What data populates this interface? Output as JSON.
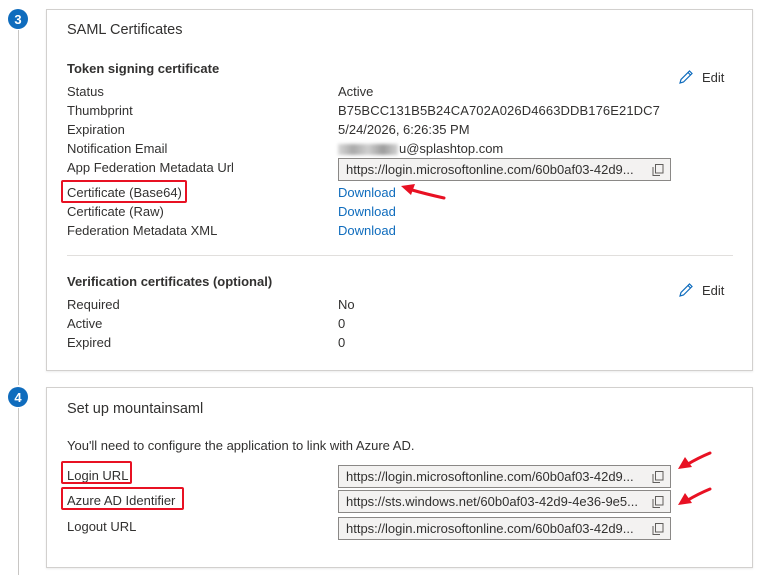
{
  "steps": [
    "3",
    "4"
  ],
  "saml": {
    "title": "SAML Certificates",
    "token_title": "Token signing certificate",
    "edit_label": "Edit",
    "rows": [
      {
        "label": "Status",
        "value": "Active"
      },
      {
        "label": "Thumbprint",
        "value": "B75BCC131B5B24CA702A026D4663DDB176E21DC7"
      },
      {
        "label": "Expiration",
        "value": "5/24/2026, 6:26:35 PM"
      },
      {
        "label": "Notification Email",
        "value": "u@splashtop.com"
      }
    ],
    "metadata_url": {
      "label": "App Federation Metadata Url",
      "value": "https://login.microsoftonline.com/60b0af03-42d9..."
    },
    "downloads": [
      {
        "label": "Certificate (Base64)",
        "link": "Download"
      },
      {
        "label": "Certificate (Raw)",
        "link": "Download"
      },
      {
        "label": "Federation Metadata XML",
        "link": "Download"
      }
    ],
    "verification_title": "Verification certificates (optional)",
    "verification_rows": [
      {
        "label": "Required",
        "value": "No"
      },
      {
        "label": "Active",
        "value": "0"
      },
      {
        "label": "Expired",
        "value": "0"
      }
    ]
  },
  "setup": {
    "title": "Set up mountainsaml",
    "description": "You'll need to configure the application to link with Azure AD.",
    "fields": [
      {
        "label": "Login URL",
        "value": "https://login.microsoftonline.com/60b0af03-42d9..."
      },
      {
        "label": "Azure AD Identifier",
        "value": "https://sts.windows.net/60b0af03-42d9-4e36-9e5..."
      },
      {
        "label": "Logout URL",
        "value": "https://login.microsoftonline.com/60b0af03-42d9..."
      }
    ]
  },
  "colors": {
    "accent": "#0f6cbd",
    "highlight": "#e81123"
  }
}
